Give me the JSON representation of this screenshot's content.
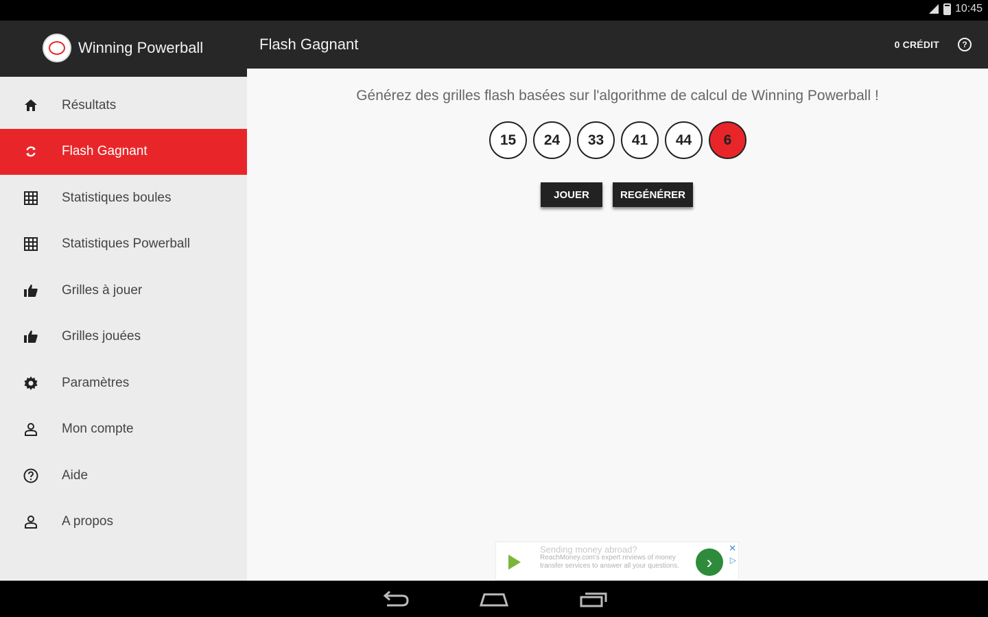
{
  "status_bar": {
    "time": "10:45"
  },
  "app_bar": {
    "app_name": "Winning Powerball",
    "page_title": "Flash Gagnant",
    "credit": "0 CRÉDIT",
    "help_icon": "help-circle-icon"
  },
  "sidebar": {
    "items": [
      {
        "label": "Résultats",
        "icon": "home-icon",
        "active": false
      },
      {
        "label": "Flash Gagnant",
        "icon": "refresh-icon",
        "active": true
      },
      {
        "label": "Statistiques boules",
        "icon": "grid-icon",
        "active": false
      },
      {
        "label": "Statistiques Powerball",
        "icon": "grid-icon",
        "active": false
      },
      {
        "label": "Grilles à jouer",
        "icon": "thumbs-up-icon",
        "active": false
      },
      {
        "label": "Grilles jouées",
        "icon": "thumbs-up-icon",
        "active": false
      },
      {
        "label": "Paramètres",
        "icon": "gear-icon",
        "active": false
      },
      {
        "label": "Mon compte",
        "icon": "person-icon",
        "active": false
      },
      {
        "label": "Aide",
        "icon": "help-circle-icon",
        "active": false
      },
      {
        "label": "A propos",
        "icon": "person-icon",
        "active": false
      }
    ]
  },
  "main": {
    "subtitle": "Générez des grilles flash basées sur l'algorithme de calcul de Winning Powerball !",
    "balls": [
      "15",
      "24",
      "33",
      "41",
      "44"
    ],
    "powerball": "6",
    "play_label": "JOUER",
    "regenerate_label": "REGÉNÉRER"
  },
  "ad": {
    "headline": "Sending money abroad?",
    "body": "ReachMoney.com's expert reviews of money transfer services to answer all your questions.",
    "go_icon": "chevron-right-icon",
    "close_icon": "close-icon",
    "info_icon": "adchoices-icon"
  },
  "nav_bar": {
    "buttons": [
      "back-icon",
      "home-icon",
      "recents-icon"
    ]
  },
  "colors": {
    "accent": "#e8262a",
    "app_bar": "#272727",
    "sidebar": "#ececec",
    "content": "#f8f8f8",
    "button": "#222222",
    "ad_button": "#2e8b3c"
  }
}
